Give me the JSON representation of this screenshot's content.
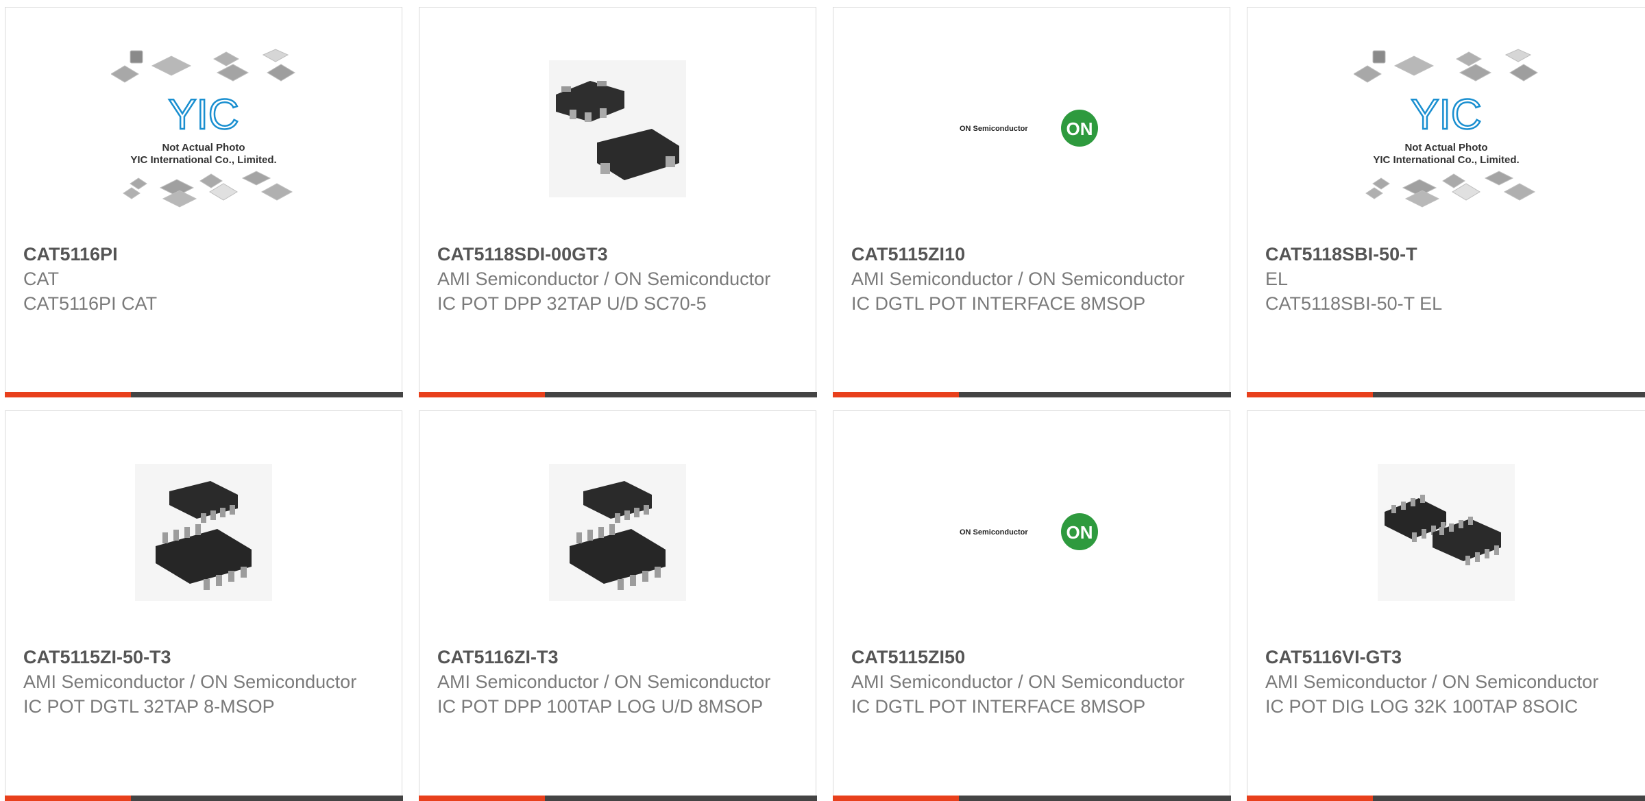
{
  "products": [
    {
      "part": "CAT5116PI",
      "maker": "CAT",
      "desc": "CAT5116PI CAT",
      "image": "yic-placeholder"
    },
    {
      "part": "CAT5118SDI-00GT3",
      "maker": "AMI Semiconductor / ON Semiconductor",
      "desc": "IC POT DPP 32TAP U/D SC70-5",
      "image": "sc70-package"
    },
    {
      "part": "CAT5115ZI10",
      "maker": "AMI Semiconductor / ON Semiconductor",
      "desc": "IC DGTL POT INTERFACE 8MSOP",
      "image": "on-semi-logo"
    },
    {
      "part": "CAT5118SBI-50-T",
      "maker": "EL",
      "desc": "CAT5118SBI-50-T EL",
      "image": "yic-placeholder"
    },
    {
      "part": "CAT5115ZI-50-T3",
      "maker": "AMI Semiconductor / ON Semiconductor",
      "desc": "IC POT DGTL 32TAP 8-MSOP",
      "image": "msop-package"
    },
    {
      "part": "CAT5116ZI-T3",
      "maker": "AMI Semiconductor / ON Semiconductor",
      "desc": "IC POT DPP 100TAP LOG U/D 8MSOP",
      "image": "msop-package"
    },
    {
      "part": "CAT5115ZI50",
      "maker": "AMI Semiconductor / ON Semiconductor",
      "desc": "IC DGTL POT INTERFACE 8MSOP",
      "image": "on-semi-logo"
    },
    {
      "part": "CAT5116VI-GT3",
      "maker": "AMI Semiconductor / ON Semiconductor",
      "desc": "IC POT DIG LOG 32K 100TAP 8SOIC",
      "image": "soic-package"
    }
  ],
  "placeholder": {
    "logo_text": "YIC",
    "line1": "Not Actual Photo",
    "line2": "YIC International Co., Limited."
  },
  "on_logo": {
    "wordmark": "ON Semiconductor",
    "badge": "ON"
  },
  "colors": {
    "accent": "#e8401c",
    "bar": "#444444",
    "on_green": "#2e9a3e",
    "yic_blue": "#1a8fd0"
  }
}
